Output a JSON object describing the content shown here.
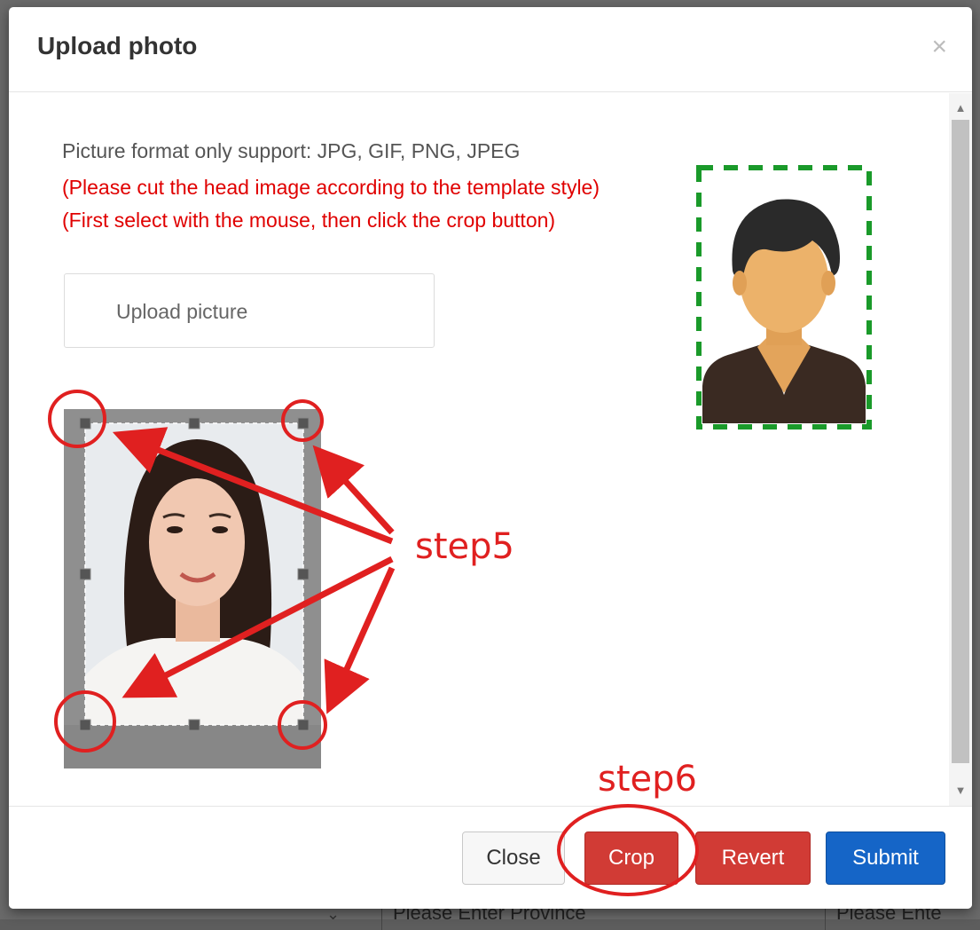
{
  "modal": {
    "title": "Upload photo",
    "close_icon": "close-icon"
  },
  "body": {
    "format_note": "Picture format only support: JPG, GIF, PNG, JPEG",
    "instruction_1": "(Please cut the head image according to the template style)",
    "instruction_2": "(First select with the mouse, then click the crop button)",
    "upload_label": "Upload picture"
  },
  "annotations": {
    "step5": "step5",
    "step6": "step6",
    "annotation_color": "#e02020",
    "template_border_color": "#1a9a2a"
  },
  "footer": {
    "close_label": "Close",
    "crop_label": "Crop",
    "revert_label": "Revert",
    "submit_label": "Submit"
  },
  "background_page": {
    "province_placeholder": "Please Enter Province",
    "second_placeholder": "Please Ente"
  },
  "colors": {
    "danger": "#d13b35",
    "primary": "#1565c7",
    "instruction_text": "#e00000"
  }
}
